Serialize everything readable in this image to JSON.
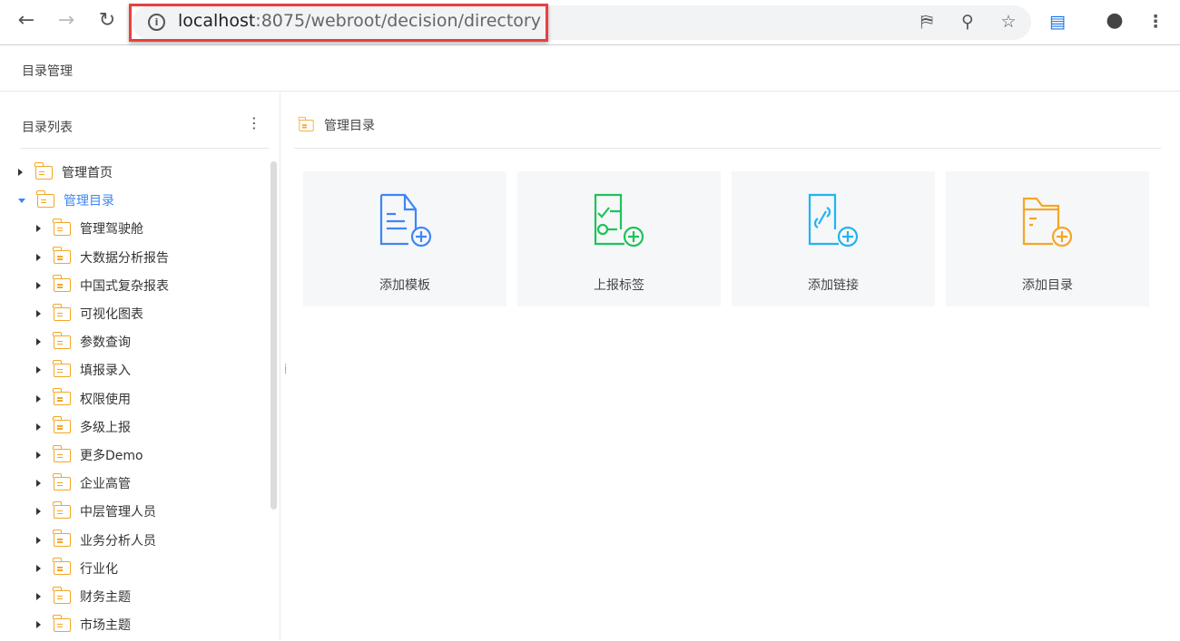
{
  "browser": {
    "url_host": "localhost",
    "url_path": ":8075/webroot/decision/directory",
    "icons": [
      "back-icon",
      "forward-icon",
      "reload-icon",
      "info-icon",
      "translate-icon",
      "zoom-icon",
      "star-icon",
      "extension-icon",
      "account-icon",
      "menu-icon"
    ]
  },
  "header": {
    "title": "目录管理"
  },
  "sidebar": {
    "title": "目录列表",
    "items": [
      {
        "label": "管理首页",
        "level": 0,
        "expanded": false
      },
      {
        "label": "管理目录",
        "level": 0,
        "expanded": true,
        "active": true
      },
      {
        "label": "管理驾驶舱",
        "level": 1
      },
      {
        "label": "大数据分析报告",
        "level": 1
      },
      {
        "label": "中国式复杂报表",
        "level": 1
      },
      {
        "label": "可视化图表",
        "level": 1
      },
      {
        "label": "参数查询",
        "level": 1
      },
      {
        "label": "填报录入",
        "level": 1
      },
      {
        "label": "权限使用",
        "level": 1
      },
      {
        "label": "多级上报",
        "level": 1
      },
      {
        "label": "更多Demo",
        "level": 1
      },
      {
        "label": "企业高管",
        "level": 1
      },
      {
        "label": "中层管理人员",
        "level": 1
      },
      {
        "label": "业务分析人员",
        "level": 1
      },
      {
        "label": "行业化",
        "level": 1
      },
      {
        "label": "财务主题",
        "level": 1
      },
      {
        "label": "市场主题",
        "level": 1
      }
    ]
  },
  "main": {
    "title": "管理目录",
    "cards": [
      {
        "label": "添加模板",
        "color": "#3d86f5"
      },
      {
        "label": "上报标签",
        "color": "#1fc25a"
      },
      {
        "label": "添加链接",
        "color": "#1fb5ef"
      },
      {
        "label": "添加目录",
        "color": "#f5a623"
      }
    ]
  }
}
